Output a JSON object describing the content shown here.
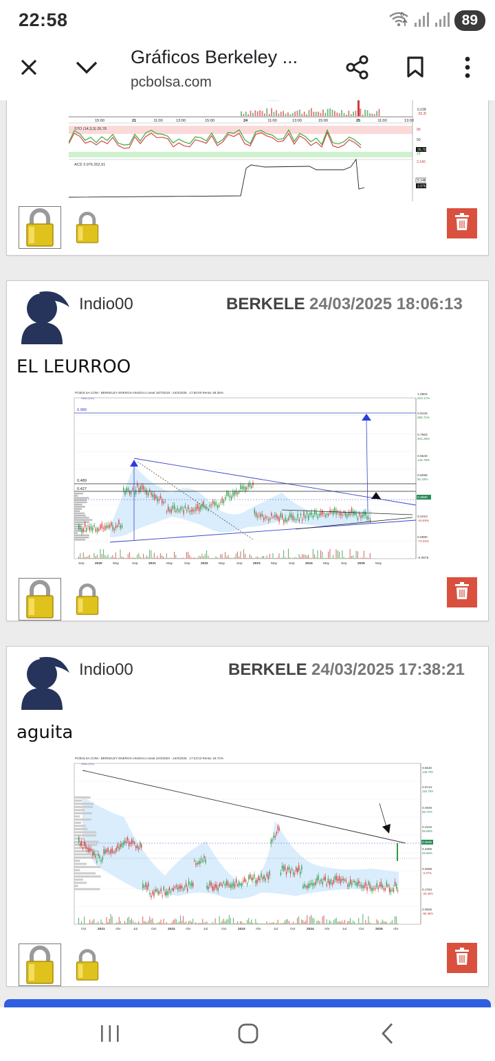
{
  "status_bar": {
    "time": "22:58",
    "battery": "89",
    "icons": [
      "wifi-6-icon",
      "signal-icon",
      "signal-icon"
    ]
  },
  "app_bar": {
    "title": "Gráficos Berkeley ...",
    "url": "pcbolsa.com",
    "icons": [
      "close-icon",
      "chevron-down-icon",
      "share-icon",
      "bookmark-icon",
      "more-vert-icon"
    ]
  },
  "posts": [
    {
      "chart": {
        "x_labels": [
          "15:00",
          "21",
          "11:00",
          "13:00",
          "15:00",
          "24",
          "11:00",
          "13:00",
          "15:00",
          "25",
          "11:00",
          "13:00"
        ],
        "price_labels": [
          "0.2398",
          "-35.35%"
        ],
        "sto_label": "STO (14,3,3)",
        "sto_value": "26,78",
        "sto_levels": [
          "90",
          "50",
          "10"
        ],
        "sto_tag": "26,702",
        "acd_label": "ACD",
        "acd_value": "3.976.352,91",
        "acd_tag": "3.976.35",
        "acd_right_labels": [
          "3.140.333",
          "5.148.341",
          "3.976.35"
        ]
      }
    },
    {
      "user": "Indio00",
      "ticker": "BERKELE",
      "timestamp": "24/03/2025 18:06:13",
      "message": "EL LEURROO",
      "chart": {
        "header": "PCBOLSA.COM - BERKELEY ENERGIA Histórico Lineal 18/7/2018 - 24/3/2025 . 17:50:00 Renta: 58.35%",
        "legend": "SMA (100)",
        "left_labels": [
          "0.989",
          "0.489",
          "0.427"
        ],
        "right_labels": [
          {
            "v": "1.0803",
            "p": "210.17%"
          },
          {
            "v": "0.9426",
            "p": "255.71%"
          },
          {
            "v": "0.7983",
            "p": "201.29%"
          },
          {
            "v": "0.6540",
            "p": "146.79%"
          },
          {
            "v": "0.5096",
            "p": "92.33%"
          },
          {
            "v": "0.3650",
            "p": ""
          },
          {
            "v": "0.2210",
            "p": "-16.59%"
          },
          {
            "v": "0.0680",
            "p": "-74.33%"
          },
          {
            "v": "-0.0676",
            "p": ""
          }
        ],
        "x_labels": [
          "Sep",
          "2020",
          "May",
          "Sep",
          "2021",
          "May",
          "Sep",
          "2022",
          "May",
          "Sep",
          "2023",
          "May",
          "Sep",
          "2024",
          "May",
          "Sep",
          "2025",
          "May"
        ]
      }
    },
    {
      "user": "Indio00",
      "ticker": "BERKELE",
      "timestamp": "24/03/2025 17:38:21",
      "message": "aguita",
      "chart": {
        "header": "PCBOLSA.COM - BERKELEY ENERGIA Histórico Lineal 24/3/2020 - 24/3/2025 . 17:23:13 Renta: 18.72%",
        "legend": "SMA (100)",
        "right_labels": [
          {
            "v": "0.6540",
            "p": "146.79%"
          },
          {
            "v": "0.5744",
            "p": "116.75%"
          },
          {
            "v": "0.4948",
            "p": "86.72%"
          },
          {
            "v": "0.4152",
            "p": "56.69%"
          },
          {
            "v": "0.3645",
            "p": ""
          },
          {
            "v": "0.3356",
            "p": "26.66%"
          },
          {
            "v": "0.2568",
            "p": "-3.37%"
          },
          {
            "v": "0.1764",
            "p": "-33.40%"
          },
          {
            "v": "0.0926",
            "p": "-90.38%"
          }
        ],
        "x_labels": [
          "Oct",
          "2021",
          "Abr",
          "Jul",
          "Oct",
          "2022",
          "Abr",
          "Jul",
          "Oct",
          "2023",
          "Abr",
          "Jul",
          "Oct",
          "2024",
          "Abr",
          "Jul",
          "Oct",
          "2025",
          "Abr"
        ]
      }
    }
  ],
  "colors": {
    "trash": "#d9503f",
    "accent_blue": "#2f5fe0",
    "candle_up": "#2e9a45",
    "candle_down": "#d23a3a",
    "band_fill": "#cfe8fb",
    "avatar": "#26335a"
  },
  "nav_bar": {
    "icons": [
      "recent-apps-icon",
      "home-icon",
      "back-icon"
    ]
  }
}
